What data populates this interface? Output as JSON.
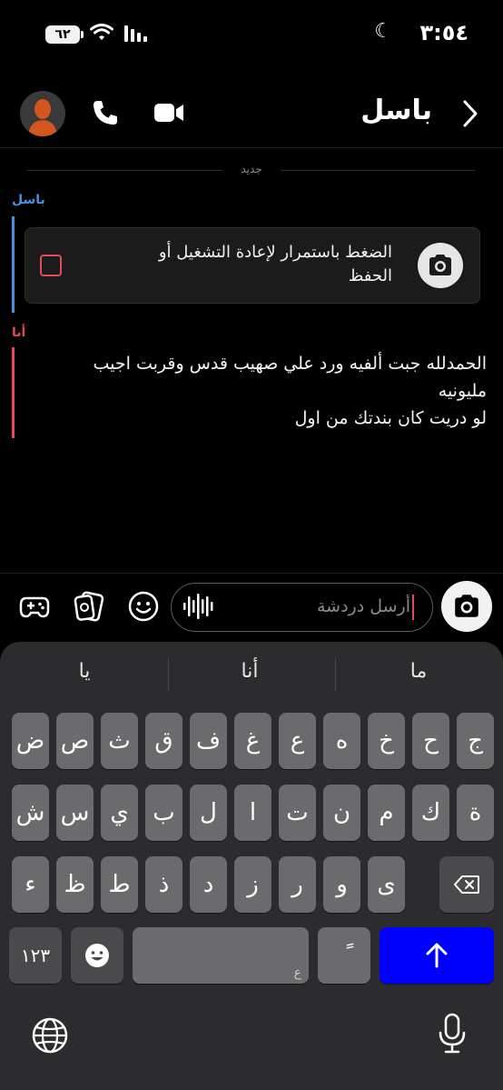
{
  "status": {
    "time": "٣:٥٤",
    "battery": "٦٢"
  },
  "header": {
    "name": "باسل"
  },
  "divider": {
    "label": "جديد"
  },
  "messages": [
    {
      "sender": "باسل",
      "color": "#4a90e2",
      "card_text": "الضغط باستمرار لإعادة التشغيل أو الحفظ"
    },
    {
      "sender": "أنا",
      "color": "#e8485a",
      "lines": [
        "الحمدلله جبت ألفيه ورد علي صهيب قدس وقربت اجيب",
        "مليونيه",
        "لو دريت كان بندتك من اول"
      ]
    }
  ],
  "input": {
    "placeholder": "أرسل دردشة"
  },
  "keyboard": {
    "suggestions": [
      "ما",
      "أنا",
      "يا"
    ],
    "row1": [
      "ج",
      "ح",
      "خ",
      "ه",
      "ع",
      "غ",
      "ف",
      "ق",
      "ث",
      "ص",
      "ض"
    ],
    "row2": [
      "ة",
      "ك",
      "م",
      "ن",
      "ت",
      "ا",
      "ل",
      "ب",
      "ي",
      "س",
      "ش"
    ],
    "row3": [
      "ى",
      "و",
      "ر",
      "ز",
      "د",
      "ذ",
      "ط",
      "ظ",
      "ء"
    ],
    "numbers_label": "١٢٣",
    "tanween_label": "ً",
    "space_hint": "ع",
    "accent": "#0000ff"
  }
}
